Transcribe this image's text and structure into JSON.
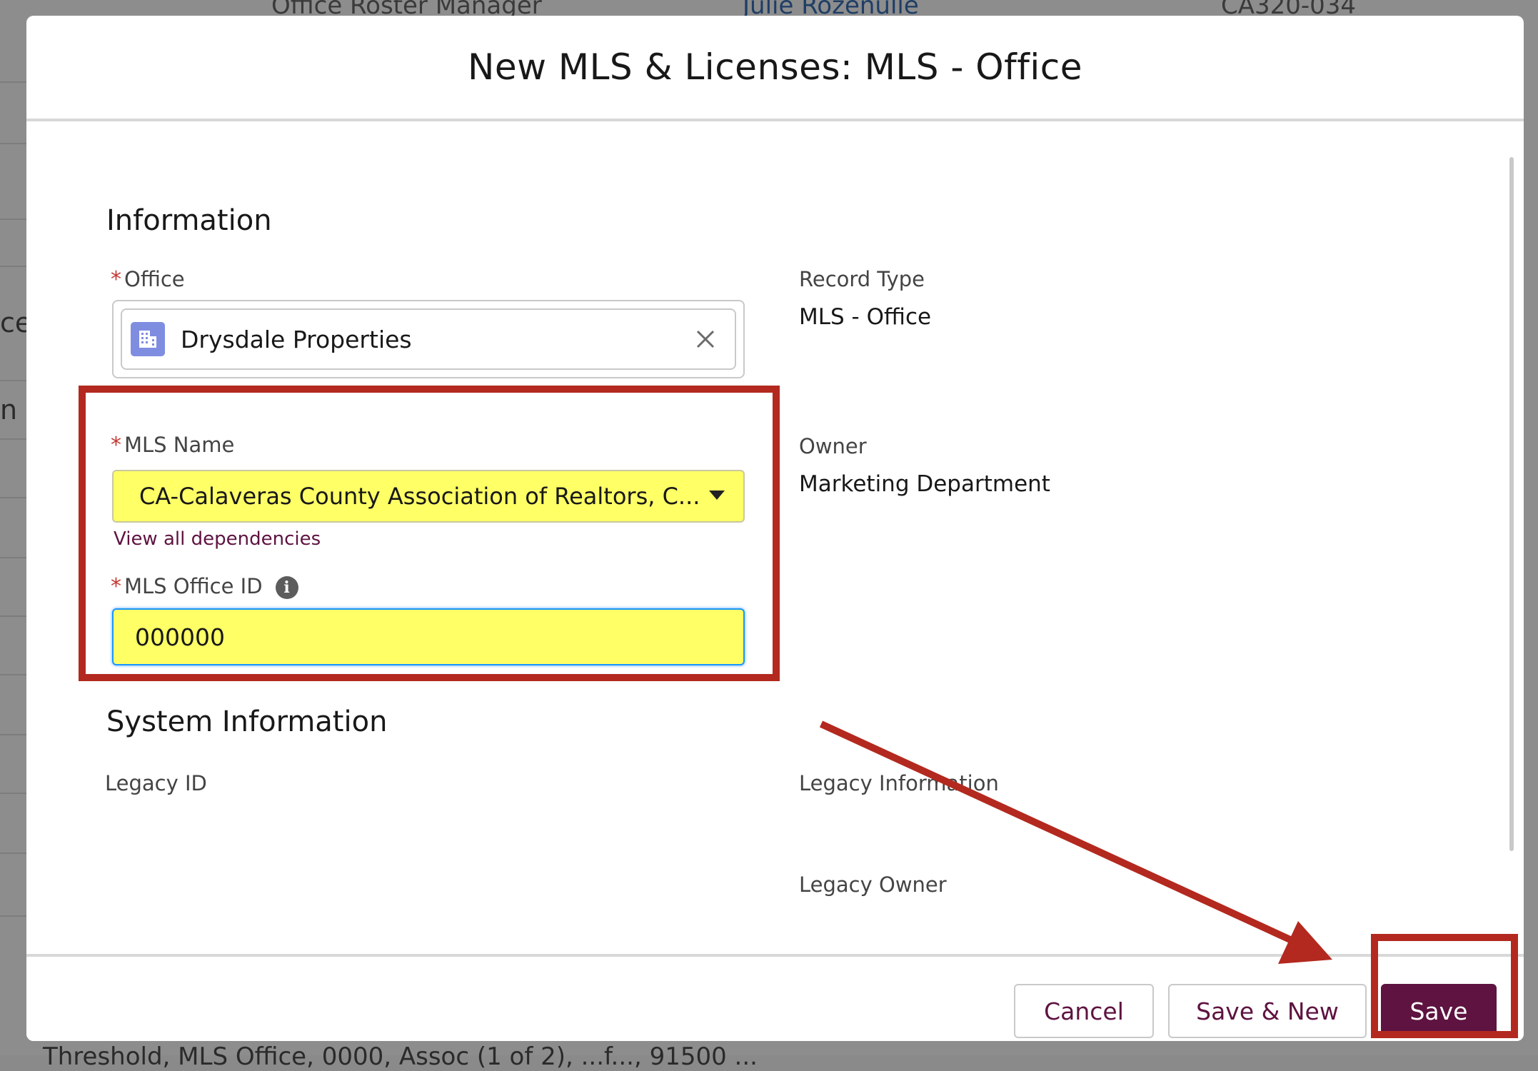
{
  "background": {
    "top_texts": [
      "Office Roster Manager",
      "Julie Rozenulle",
      "CA320-034"
    ],
    "side_texts": [
      "ce",
      "n II"
    ],
    "bottom_text": "Threshold, MLS Office, 0000, Assoc (1 of 2), ...f..., 91500 ..."
  },
  "modal": {
    "title": "New MLS & Licenses: MLS - Office",
    "section_information": "Information",
    "office_label": "Office",
    "office_value": "Drysdale Properties",
    "record_type_label": "Record Type",
    "record_type_value": "MLS - Office",
    "mls_name_label": "MLS Name",
    "mls_name_value": "CA-Calaveras County Association of Realtors, C...",
    "view_dependencies": "View all dependencies",
    "mls_office_id_label": "MLS Office ID",
    "mls_office_id_value": "000000",
    "owner_label": "Owner",
    "owner_value": "Marketing Department",
    "section_system": "System Information",
    "legacy_id_label": "Legacy ID",
    "legacy_information_label": "Legacy Information",
    "legacy_owner_label": "Legacy Owner",
    "required_marker": "*"
  },
  "footer": {
    "cancel_label": "Cancel",
    "save_new_label": "Save & New",
    "save_label": "Save"
  },
  "colors": {
    "brand": "#5e1340",
    "highlight": "#ffff66",
    "annotation": "#b3291f",
    "required": "#c23934"
  }
}
